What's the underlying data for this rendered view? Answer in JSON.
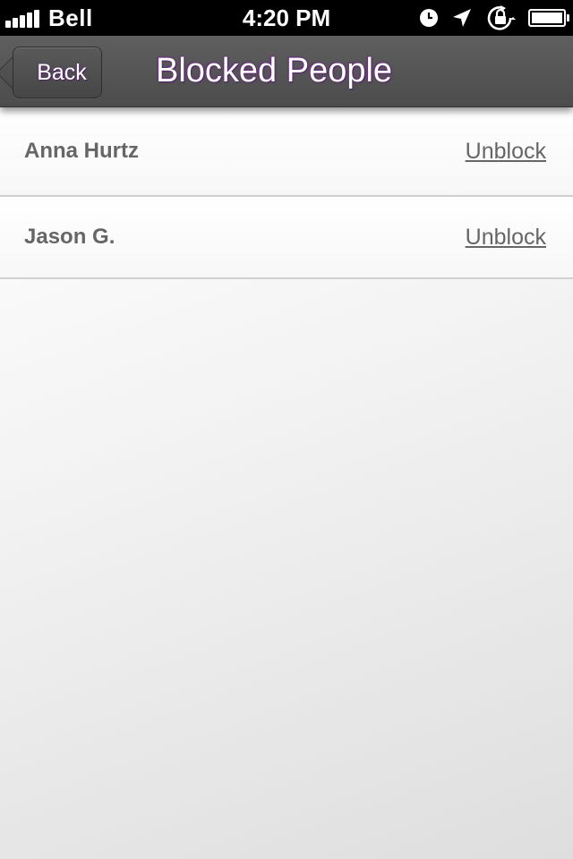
{
  "status_bar": {
    "carrier": "Bell",
    "time": "4:20 PM",
    "icons": [
      "signal-icon",
      "clock-icon",
      "location-icon",
      "rotation-lock-icon",
      "battery-icon"
    ]
  },
  "nav": {
    "back_label": "Back",
    "title": "Blocked People"
  },
  "blocked": [
    {
      "name": "Anna Hurtz",
      "action": "Unblock"
    },
    {
      "name": "Jason G.",
      "action": "Unblock"
    }
  ],
  "colors": {
    "nav_bg": "#555555",
    "title_glow": "#6a2e80",
    "text_gray": "#666666"
  }
}
